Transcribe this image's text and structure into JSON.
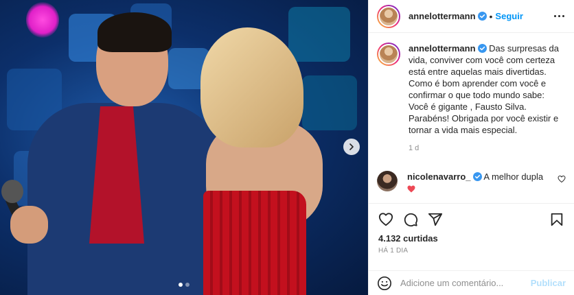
{
  "post": {
    "author": "annelottermann",
    "follow_label": "Seguir",
    "separator": "•",
    "image_slide_count": 2,
    "image_active_slide": 1,
    "caption": "Das surpresas da vida, conviver com você com certeza está entre aquelas mais divertidas. Como é bom aprender com você e confirmar o que todo mundo sabe: Você é gigante , Fausto Silva. Parabéns! Obrigada por você existir e tornar a vida mais especial.",
    "caption_age": "1 d"
  },
  "comments": [
    {
      "user": "nicolenavarro_",
      "text": "A melhor dupla",
      "emoji": "heart"
    }
  ],
  "actions": {
    "likes": "4.132 curtidas",
    "timestamp": "HÁ 1 DIA"
  },
  "add_comment": {
    "placeholder": "Adicione um comentário...",
    "publish_label": "Publicar"
  },
  "colors": {
    "accent": "#0095f6",
    "publish_disabled": "#b2dffc",
    "verified": "#3897f0",
    "heart": "#ed4956"
  },
  "icons": [
    "verified-icon",
    "more-icon",
    "like-icon",
    "comment-icon",
    "share-icon",
    "save-icon",
    "emoji-icon",
    "next-icon"
  ]
}
